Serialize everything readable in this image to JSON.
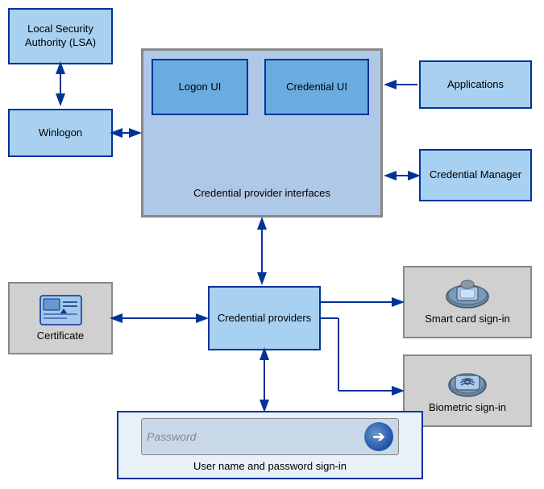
{
  "boxes": {
    "lsa": {
      "label": "Local Security\nAuthority (LSA)"
    },
    "winlogon": {
      "label": "Winlogon"
    },
    "applications": {
      "label": "Applications"
    },
    "credential_manager": {
      "label": "Credential\nManager"
    },
    "logon_ui": {
      "label": "Logon UI"
    },
    "credential_ui": {
      "label": "Credential\nUI"
    },
    "credential_provider_interfaces": {
      "label": "Credential provider\ninterfaces"
    },
    "credential_providers": {
      "label": "Credential\nproviders"
    },
    "certificate": {
      "label": "Certificate"
    },
    "smart_card": {
      "label": "Smart card sign-in"
    },
    "biometric": {
      "label": "Biometric sign-in"
    },
    "password_label": {
      "label": "User name and password sign-in"
    },
    "password_placeholder": {
      "label": "Password"
    }
  }
}
